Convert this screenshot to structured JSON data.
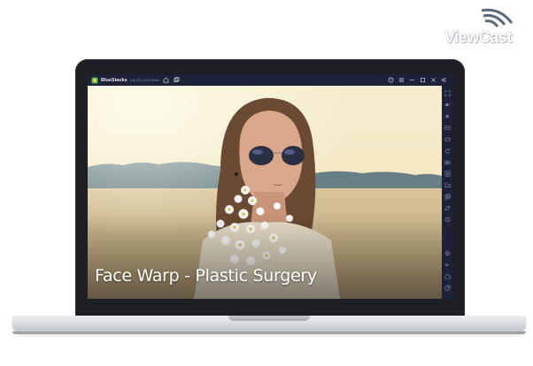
{
  "watermark": {
    "brand": "ViewCast"
  },
  "window": {
    "app_name": "BlueStacks",
    "version_text": "5.8.101.1002 Beta",
    "left_icons": [
      "home-icon",
      "multi-instance-icon"
    ],
    "right_icons": [
      "help-icon",
      "menu-icon",
      "minimize-icon",
      "maximize-icon",
      "close-icon",
      "collapse-sidebar-icon"
    ]
  },
  "app": {
    "title": "Face Warp - Plastic Surgery"
  },
  "sidebar": {
    "items": [
      "fullscreen-icon",
      "volume-up-icon",
      "volume-down-icon",
      "keyboard-icon",
      "gamepad-icon",
      "rotate-icon",
      "screenshot-icon",
      "macro-icon",
      "folder-icon",
      "copy-icon",
      "eco-mode-icon",
      "sync-icon",
      "settings-icon",
      "back-icon",
      "home-icon",
      "recent-apps-icon"
    ]
  },
  "colors": {
    "titlebar": "#1d2238",
    "bezel": "#1e1f24",
    "accent": "#4a8df0"
  }
}
